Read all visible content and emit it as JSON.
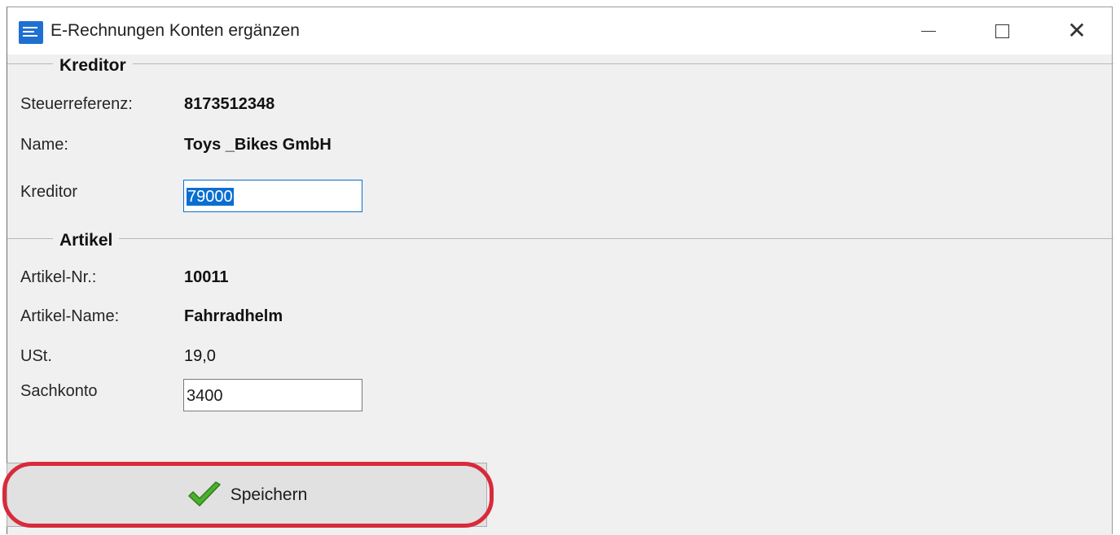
{
  "window": {
    "title": "E-Rechnungen Konten ergänzen",
    "controls": {
      "minimize": "—",
      "maximize": "☐",
      "close": "✕"
    }
  },
  "kreditor_group": {
    "title": "Kreditor",
    "steuerreferenz_label": "Steuerreferenz:",
    "steuerreferenz_value": "8173512348",
    "name_label": "Name:",
    "name_value": "Toys _Bikes GmbH",
    "kreditor_label": "Kreditor",
    "kreditor_value": "79000"
  },
  "artikel_group": {
    "title": "Artikel",
    "artikel_nr_label": "Artikel-Nr.:",
    "artikel_nr_value": "10011",
    "artikel_name_label": "Artikel-Name:",
    "artikel_name_value": "Fahrradhelm",
    "ust_label": "USt.",
    "ust_value": "19,0",
    "sachkonto_label": "Sachkonto",
    "sachkonto_value": "3400"
  },
  "actions": {
    "save_label": "Speichern",
    "save_icon": "checkmark-icon"
  },
  "colors": {
    "highlight": "#d82a3b",
    "accent": "#0a6ed1",
    "check": "#4caf2e"
  }
}
